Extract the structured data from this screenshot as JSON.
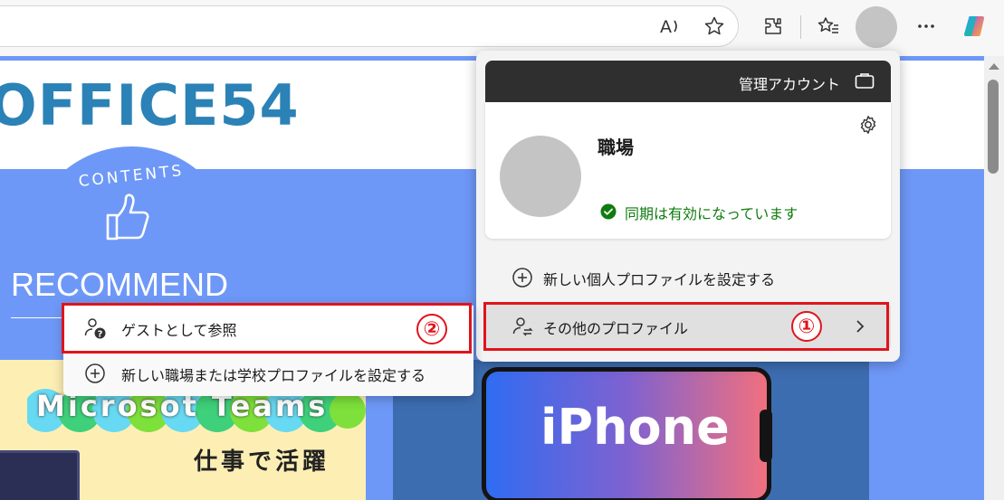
{
  "toolbar": {
    "icons": [
      "read-aloud-icon",
      "favorite-star-icon",
      "extensions-icon",
      "favorites-list-icon",
      "profile-avatar-icon",
      "more-icon",
      "copilot-icon"
    ]
  },
  "page": {
    "site_title": "OFFICE54",
    "contents_label": "CONTENTS",
    "recommend_heading": "RECOMMEND",
    "teams_card": {
      "title": "Microsot Teams",
      "subtitle": "仕事で活躍"
    },
    "iphone_card": {
      "title": "iPhone"
    }
  },
  "profile_flyout": {
    "managed_label": "管理アカウント",
    "profile_name": "職場",
    "sync_status": "同期は有効になっています",
    "new_personal_profile": "新しい個人プロファイルを設定する",
    "other_profiles": "その他のプロファイル",
    "badge_1": "①"
  },
  "submenu": {
    "guest_browse": "ゲストとして参照",
    "new_work_profile": "新しい職場または学校プロファイルを設定する",
    "badge_2": "②"
  },
  "colors": {
    "accent_blue": "#6e98f7",
    "title_blue": "#2b82b6",
    "highlight_red": "#e0141c",
    "sync_green": "#107c10"
  }
}
